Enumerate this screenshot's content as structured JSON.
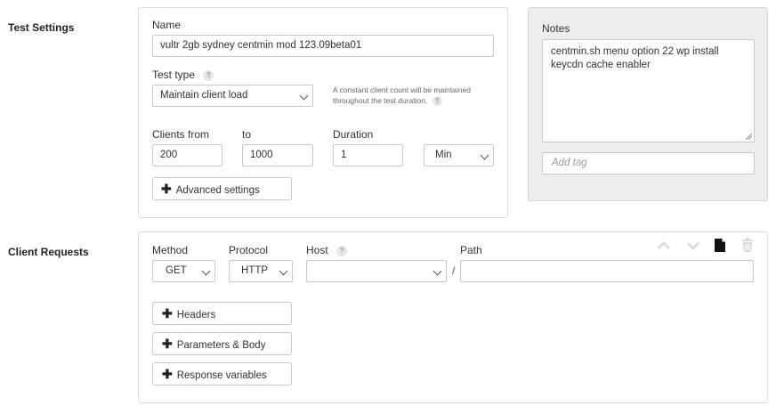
{
  "test_settings": {
    "section_label": "Test Settings",
    "name_label": "Name",
    "name_value": "vultr 2gb sydney centmin mod 123.09beta01",
    "test_type_label": "Test type",
    "test_type_help": "?",
    "test_type_value": "Maintain client load",
    "test_type_hint": "A constant client count will be maintained throughout the test duration.",
    "clients_from_label": "Clients from",
    "clients_from_value": "200",
    "to_label": "to",
    "to_value": "1000",
    "duration_label": "Duration",
    "duration_value": "1",
    "duration_unit": "Min",
    "advanced_button": "Advanced settings"
  },
  "notes": {
    "label": "Notes",
    "text": "centmin.sh menu option 22 wp install keycdn cache enabler",
    "tag_placeholder": "Add tag"
  },
  "client_requests": {
    "section_label": "Client Requests",
    "method_label": "Method",
    "method_value": "GET",
    "protocol_label": "Protocol",
    "protocol_value": "HTTP",
    "host_label": "Host",
    "host_help": "?",
    "host_value": "",
    "path_label": "Path",
    "path_separator": "/",
    "path_value": "",
    "headers_button": "Headers",
    "params_button": "Parameters & Body",
    "response_vars_button": "Response variables"
  }
}
